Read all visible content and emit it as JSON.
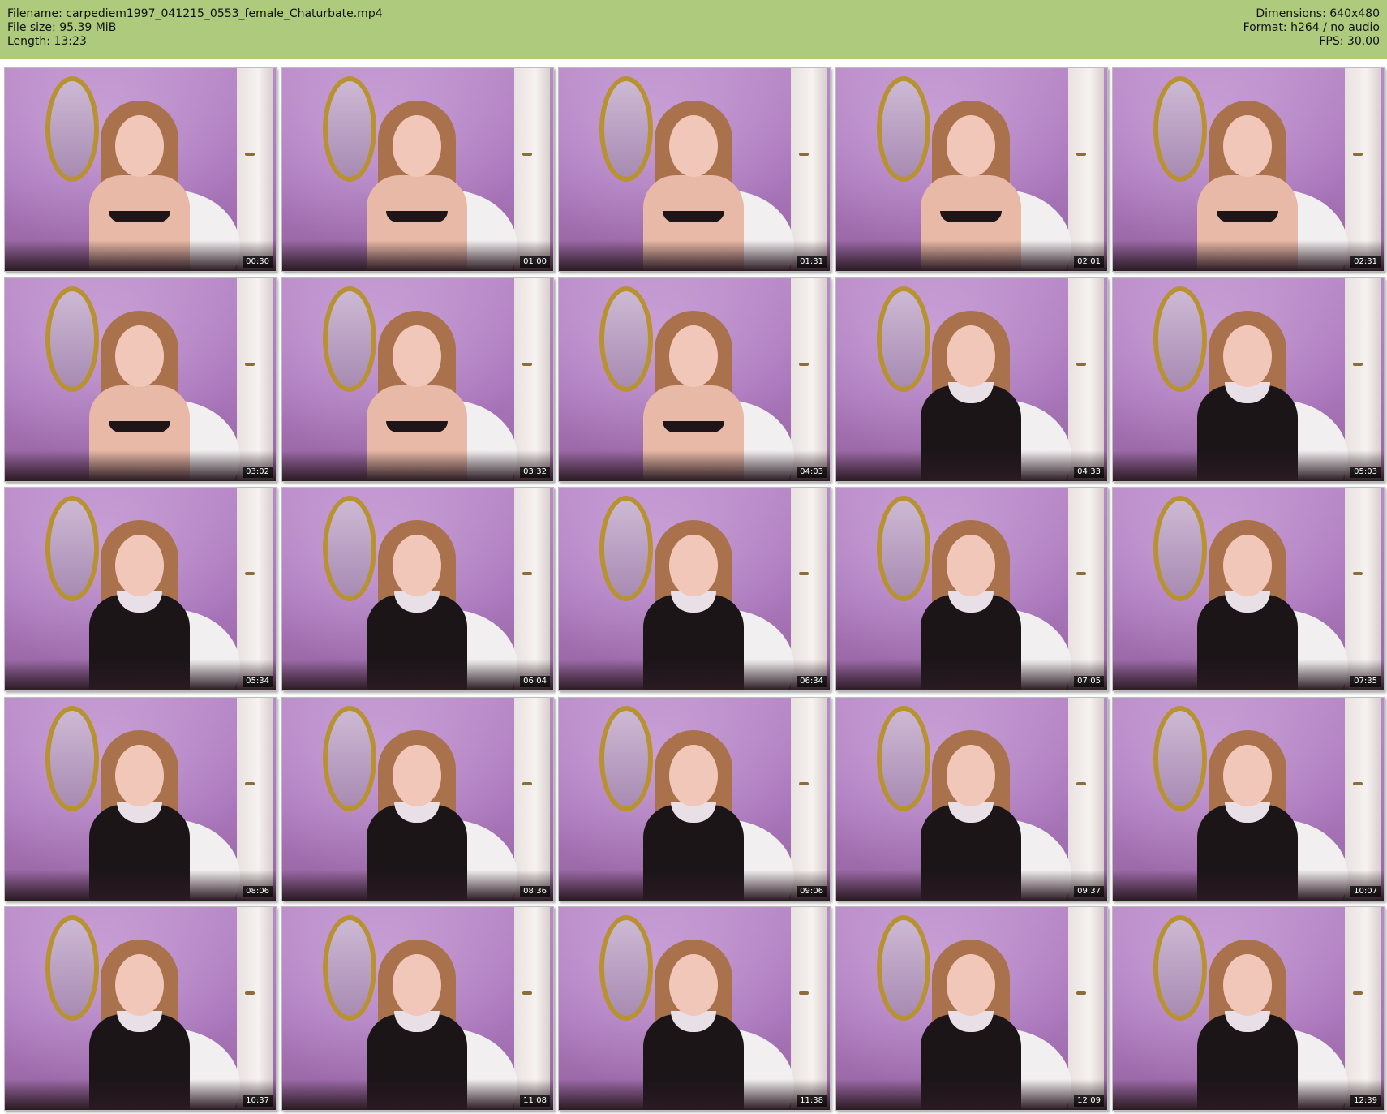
{
  "header": {
    "filename": "Filename: carpediem1997_041215_0553_female_Chaturbate.mp4",
    "file_size": "File size: 95.39 MiB",
    "length": "Length: 13:23",
    "dimensions": "Dimensions: 640x480",
    "format": "Format: h264 / no audio",
    "fps": "FPS: 30.00"
  },
  "colors": {
    "header_bg": "#aecb7d",
    "timestamp_bg": "#000000",
    "timestamp_text": "#ffffff"
  },
  "thumbnails": [
    {
      "time": "00:30"
    },
    {
      "time": "01:00"
    },
    {
      "time": "01:31"
    },
    {
      "time": "02:01"
    },
    {
      "time": "02:31"
    },
    {
      "time": "03:02"
    },
    {
      "time": "03:32"
    },
    {
      "time": "04:03"
    },
    {
      "time": "04:33"
    },
    {
      "time": "05:03"
    },
    {
      "time": "05:34"
    },
    {
      "time": "06:04"
    },
    {
      "time": "06:34"
    },
    {
      "time": "07:05"
    },
    {
      "time": "07:35"
    },
    {
      "time": "08:06"
    },
    {
      "time": "08:36"
    },
    {
      "time": "09:06"
    },
    {
      "time": "09:37"
    },
    {
      "time": "10:07"
    },
    {
      "time": "10:37"
    },
    {
      "time": "11:08"
    },
    {
      "time": "11:38"
    },
    {
      "time": "12:09"
    },
    {
      "time": "12:39"
    }
  ]
}
